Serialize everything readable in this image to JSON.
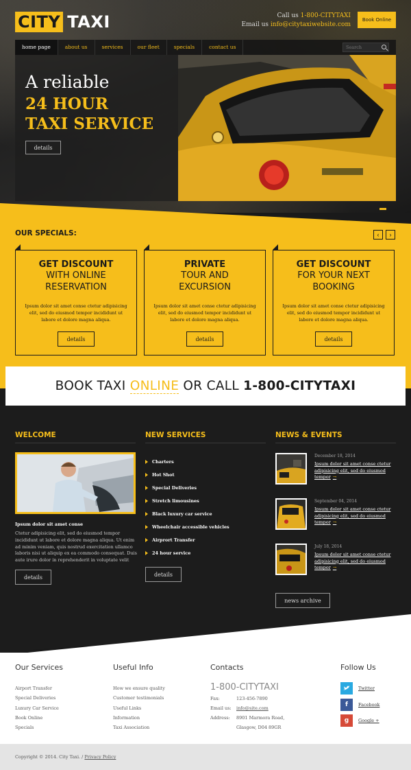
{
  "header": {
    "logo_city": "CITY",
    "logo_taxi": "TAXI",
    "call_prefix": "Call us ",
    "call_number": "1-800-CITYTAXI",
    "email_prefix": "Email us ",
    "email": "info@citytaxiwebsite.com",
    "book_button": "Book Online"
  },
  "nav": {
    "items": [
      "home page",
      "about us",
      "services",
      "our fleet",
      "specials",
      "contact us"
    ],
    "search_placeholder": "Search"
  },
  "hero": {
    "line1": "A reliable",
    "line2": "24 HOUR",
    "line3": "TAXI SERVICE",
    "button": "details"
  },
  "specials": {
    "title": "OUR SPECIALS:",
    "prev": "‹",
    "next": "›",
    "cards": [
      {
        "h1": "GET DISCOUNT",
        "h2a": "WITH ONLINE",
        "h2b": "RESERVATION",
        "text": "Ipsum dolor sit amet conse ctetur adipisicing elit, sed do eiusmod tempor incididunt ut labore et dolore magna aliqua.",
        "button": "details"
      },
      {
        "h1": "PRIVATE",
        "h2a": "TOUR AND",
        "h2b": "EXCURSION",
        "text": "Ipsum dolor sit amet conse ctetur adipisicing elit, sed do eiusmod tempor incididunt ut labore et dolore magna aliqua.",
        "button": "details"
      },
      {
        "h1": "GET DISCOUNT",
        "h2a": "FOR YOUR NEXT",
        "h2b": "BOOKING",
        "text": "Ipsum dolor sit amet conse ctetur adipisicing elit, sed do eiusmod tempor incididunt ut labore et dolore magna aliqua.",
        "button": "details"
      }
    ]
  },
  "book_bar": {
    "part1": "BOOK TAXI ",
    "online": "ONLINE",
    "part2": " OR CALL ",
    "number": "1-800-CITYTAXI"
  },
  "welcome": {
    "title": "WELCOME",
    "subtitle": "Ipsum dolor sit amet conse",
    "text": "Ctetur adipisicing elit, sed do eiusmod tempor incididunt ut labore et dolore magna aliqua. Ut enim ad minim veniam, quis nostrud exercitation ullamco laboris nisi ut aliquip ex ea commodo consequat. Duis aute irure dolor in reprehenderit in voluptate velit esse cillum dolore eu fugiat nulla pariatur consectetuer adipiscing elit. Nunc suscipit.",
    "button": "details"
  },
  "new_services": {
    "title": "NEW SERVICES",
    "items": [
      "Charters",
      "Hot Shot",
      "Special Deliveries",
      "Stretch limousines",
      "Black luxury car service",
      "Wheelchair accessible vehicles",
      "Airprort Transfer",
      "24 hour service"
    ],
    "button": "details"
  },
  "news": {
    "title": "NEWS & EVENTS",
    "items": [
      {
        "date": "December 18, 2014",
        "text": "Ipsum dolor sit amet conse ctetur adipisicing elit, sed do eiusmod tempor"
      },
      {
        "date": "September 04, 2014",
        "text": "Ipsum dolor sit amet conse ctetur adipisicing elit, sed do eiusmod tempor"
      },
      {
        "date": "July 18, 2014",
        "text": "Ipsum dolor sit amet conse ctetur adipisicing elit, sed do eiusmod tempor"
      }
    ],
    "arrow": "→",
    "button": "news archive"
  },
  "footer": {
    "services_title": "Our Services",
    "services": [
      "Airport Transfer",
      "Special Deliveries",
      "Luxury Car Service",
      "Book Online",
      "Specials"
    ],
    "info_title": "Useful Info",
    "info": [
      "How we ensure quality",
      "Customer testimonials",
      "Useful Links",
      "Information",
      "Taxi Association"
    ],
    "contacts_title": "Contacts",
    "phone": "1-800-CITYTAXI",
    "fax_label": "Fax:",
    "fax": "123-456-7890",
    "email_label": "Email us:",
    "email": "info@site.com",
    "address_label": "Address:",
    "address1": "8901 Marmora Road,",
    "address2": "Glasgow, D04 89GR",
    "follow_title": "Follow Us",
    "twitter": "Twitter",
    "facebook": "Facebook",
    "google": "Google +",
    "copyright": "Copyright © 2014. City Taxi.  /  ",
    "privacy": "Privacy Policy"
  },
  "colors": {
    "accent": "#f6be1b",
    "dark": "#1c1c1c",
    "twitter": "#29a9e1",
    "facebook": "#3b5998",
    "google": "#d64937"
  }
}
